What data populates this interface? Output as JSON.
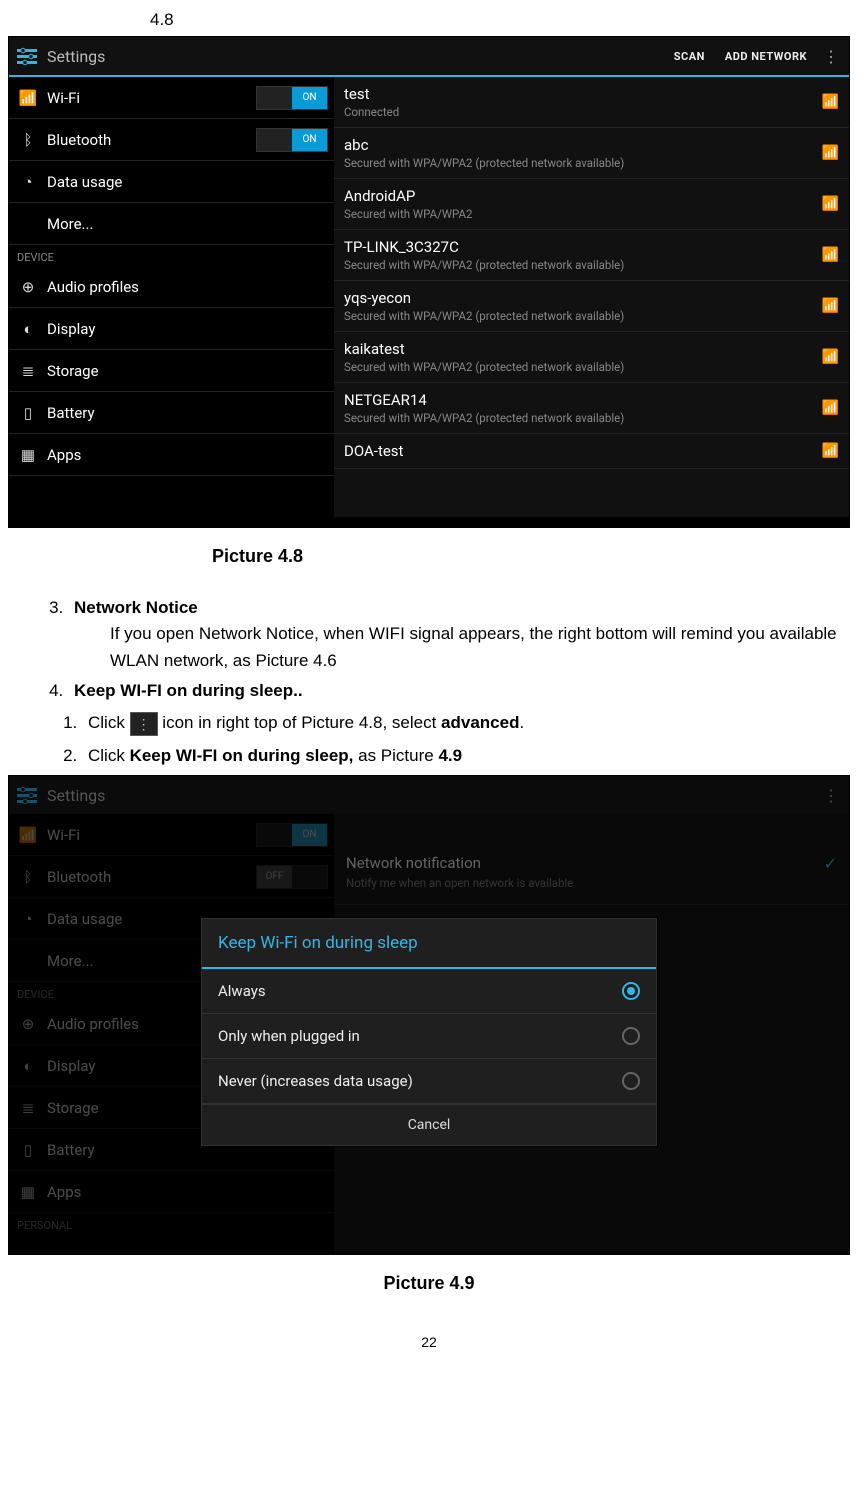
{
  "top_ref": "4.8",
  "figure1": {
    "header": {
      "title": "Settings",
      "action_scan": "SCAN",
      "action_add": "ADD NETWORK"
    },
    "left": {
      "wifi": "Wi-Fi",
      "wifi_on": "ON",
      "bluetooth": "Bluetooth",
      "bt_on": "ON",
      "data": "Data usage",
      "more": "More...",
      "sect_device": "DEVICE",
      "audio": "Audio profiles",
      "display": "Display",
      "storage": "Storage",
      "battery": "Battery",
      "apps": "Apps"
    },
    "networks": [
      {
        "name": "test",
        "sub": "Connected"
      },
      {
        "name": "abc",
        "sub": "Secured with WPA/WPA2 (protected network available)"
      },
      {
        "name": "AndroidAP",
        "sub": "Secured with WPA/WPA2"
      },
      {
        "name": "TP-LINK_3C327C",
        "sub": "Secured with WPA/WPA2 (protected network available)"
      },
      {
        "name": "yqs-yecon",
        "sub": "Secured with WPA/WPA2 (protected network available)"
      },
      {
        "name": "kaikatest",
        "sub": "Secured with WPA/WPA2 (protected network available)"
      },
      {
        "name": "NETGEAR14",
        "sub": "Secured with WPA/WPA2 (protected network available)"
      },
      {
        "name": "DOA-test",
        "sub": ""
      }
    ],
    "caption": "Picture 4.8"
  },
  "body": {
    "item3_title": "Network Notice",
    "item3_text": "If you open Network Notice, when WIFI signal appears, the right bottom will remind you available WLAN network, as Picture 4.6",
    "item4_title": "Keep WI-FI on during sleep..",
    "sub1_a": "Click ",
    "sub1_b": " icon in right top of Picture 4.8, select ",
    "sub1_c": "advanced",
    "sub1_d": ".",
    "sub2_a": "Click ",
    "sub2_b": "Keep WI-FI on during sleep,",
    "sub2_c": " as Picture ",
    "sub2_d": "4.9"
  },
  "figure2": {
    "header": {
      "title": "Settings"
    },
    "left": {
      "wifi": "Wi-Fi",
      "wifi_on": "ON",
      "bluetooth": "Bluetooth",
      "bt_off": "OFF",
      "data": "Data usage",
      "more": "More...",
      "sect_device": "DEVICE",
      "audio": "Audio profiles",
      "display": "Display",
      "storage": "Storage",
      "battery": "Battery",
      "apps": "Apps",
      "sect_personal": "PERSONAL"
    },
    "adv": {
      "title": "Network notification",
      "sub": "Notify me when an open network is available"
    },
    "dialog": {
      "title": "Keep Wi-Fi on during sleep",
      "opt1": "Always",
      "opt2": "Only when plugged in",
      "opt3": "Never (increases data usage)",
      "cancel": "Cancel"
    },
    "caption": "Picture 4.9"
  },
  "page_number": "22"
}
